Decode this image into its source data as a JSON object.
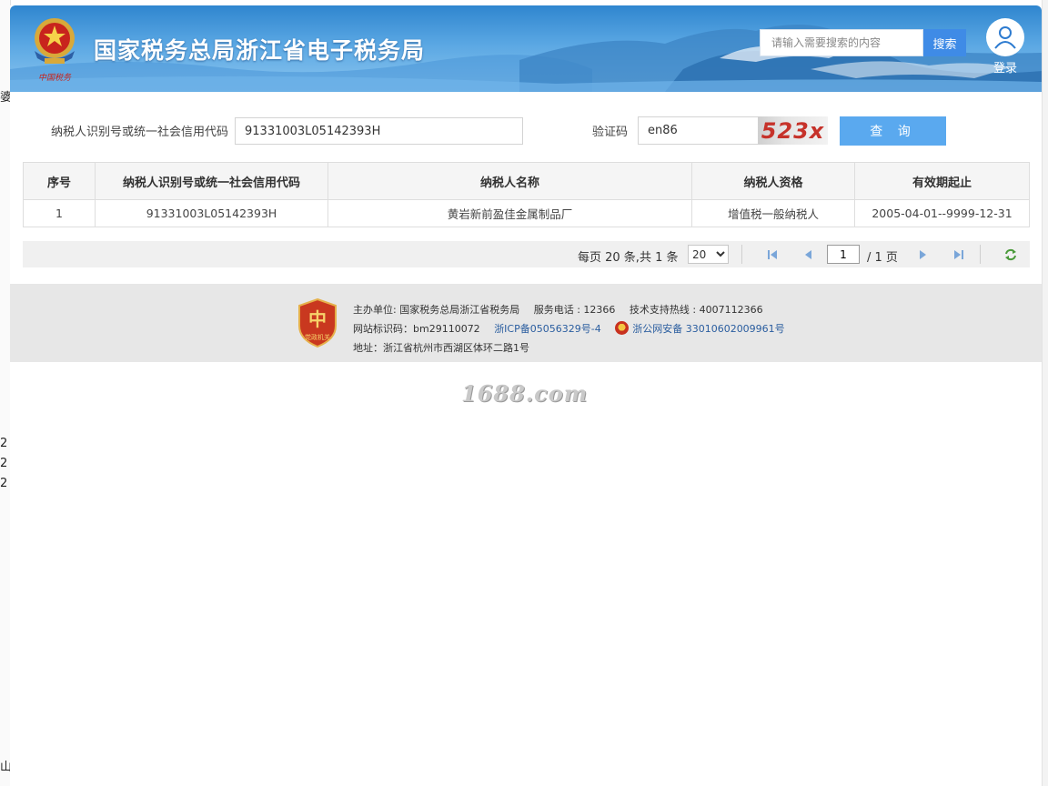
{
  "edge": {
    "chars": [
      "婆",
      "2",
      "2",
      "2",
      "山"
    ]
  },
  "header": {
    "title": "国家税务总局浙江省电子税务局",
    "search_placeholder": "请输入需要搜索的内容",
    "search_button": "搜索",
    "login_label": "登录",
    "logo_script": "中国税务"
  },
  "form": {
    "taxpayer_label": "纳税人识别号或统一社会信用代码",
    "taxpayer_value": "91331003L05142393H",
    "captcha_label": "验证码",
    "captcha_value": "en86",
    "captcha_image_text": "523x",
    "query_button": "查 询"
  },
  "table": {
    "headers": [
      "序号",
      "纳税人识别号或统一社会信用代码",
      "纳税人名称",
      "纳税人资格",
      "有效期起止"
    ],
    "rows": [
      [
        "1",
        "91331003L05142393H",
        "黄岩新前盈佳金属制品厂",
        "增值税一般纳税人",
        "2005-04-01--9999-12-31"
      ]
    ]
  },
  "pager": {
    "info": "每页 20 条,共 1 条",
    "page_size": "20",
    "page_size_options": [
      "20"
    ],
    "current_page": "1",
    "total_pages": "/ 1 页"
  },
  "footer": {
    "host": "主办单位: 国家税务总局浙江省税务局",
    "phone": "服务电话 : 12366",
    "support": "技术支持热线 : 4007112366",
    "site_id": "网站标识码：bm29110072",
    "icp": "浙ICP备05056329号-4",
    "police": "浙公网安备 33010602009961号",
    "address": "地址：浙江省杭州市西湖区体环二路1号",
    "badge_text": "党政机关"
  },
  "watermark": "1688.com",
  "colors": {
    "header_blue": "#2f86cf",
    "search_button": "#3f8be6",
    "query_button": "#5aa9ef",
    "footer_bg": "#e7e7e7",
    "link": "#2a5d9f",
    "captcha_text": "#c6322a"
  }
}
